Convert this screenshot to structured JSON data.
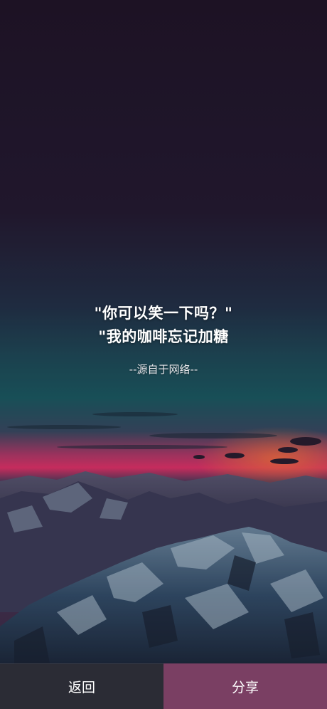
{
  "quote": {
    "line1": "\"你可以笑一下吗？\"",
    "line2": "\"我的咖啡忘记加糖",
    "source": "--源自于网络--"
  },
  "actions": {
    "back_label": "返回",
    "share_label": "分享"
  },
  "colors": {
    "back_button_bg": "#2b2c35",
    "share_button_bg": "#7a3f63",
    "sky_top": "#221628",
    "horizon_glow": "#e0336a"
  }
}
